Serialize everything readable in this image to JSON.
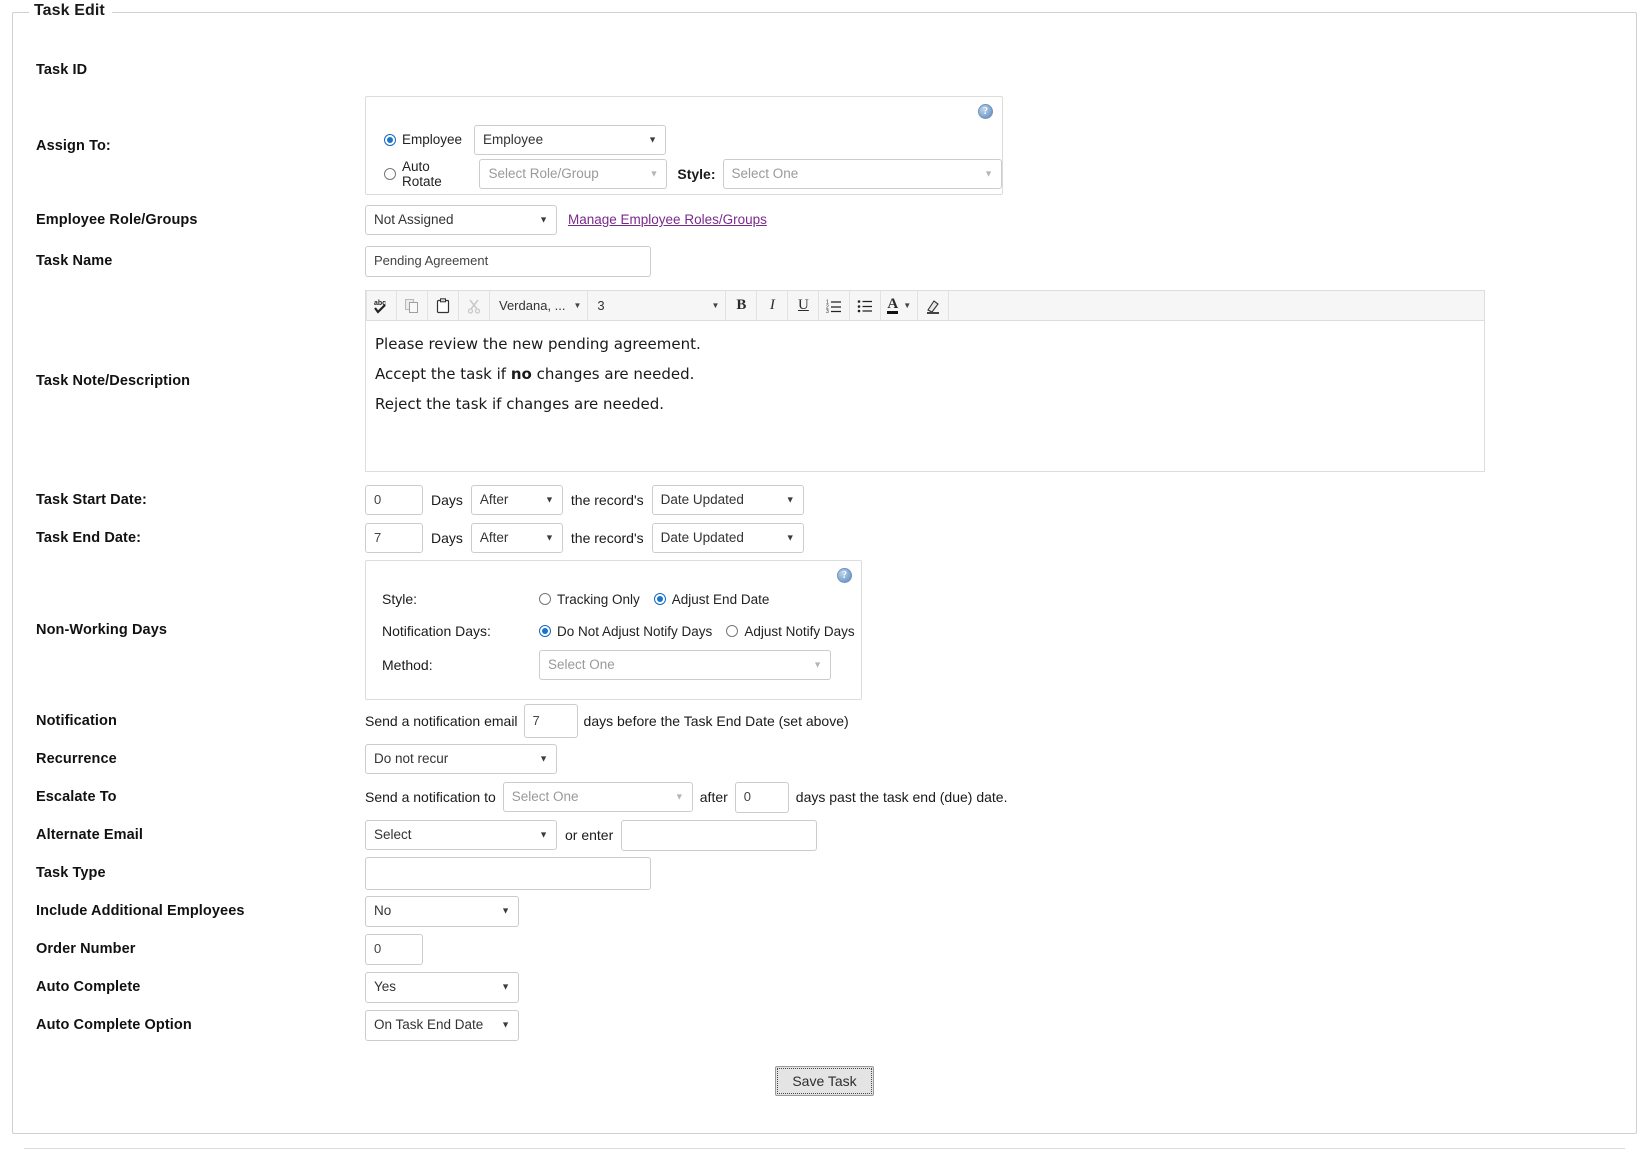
{
  "form": {
    "legend": "Task Edit",
    "save_label": "Save Task",
    "help_icon_glyph": "?"
  },
  "rows": {
    "task_id": {
      "label": "Task ID",
      "value": ""
    },
    "assign_to": {
      "label": "Assign To:",
      "employee_radio_label": "Employee",
      "employee_select_value": "Employee",
      "auto_rotate_radio_label": "Auto Rotate",
      "role_group_select_placeholder": "Select Role/Group",
      "style_label": "Style:",
      "style_select_placeholder": "Select One"
    },
    "employee_role_groups": {
      "label": "Employee Role/Groups",
      "select_value": "Not Assigned",
      "manage_link": "Manage Employee Roles/Groups"
    },
    "task_name": {
      "label": "Task Name",
      "value": "Pending Agreement"
    },
    "task_note": {
      "label": "Task Note/Description",
      "toolbar": {
        "spellcheck": "abc",
        "copy": "copy-icon",
        "paste": "paste-icon",
        "cut": "cut-icon",
        "font_value": "Verdana, ...",
        "size_value": "3",
        "bold": "B",
        "italic": "I",
        "underline": "U",
        "numbered_list": "numbered-list-icon",
        "bulleted_list": "bulleted-list-icon",
        "font_color": "A",
        "highlight": "highlight-icon"
      },
      "paragraphs": [
        {
          "pre": "Please review the new pending agreement.",
          "bold": "",
          "post": ""
        },
        {
          "pre": "Accept the task if ",
          "bold": "no",
          "post": " changes are needed."
        },
        {
          "pre": "Reject the task if changes are needed.",
          "bold": "",
          "post": ""
        }
      ]
    },
    "task_start_date": {
      "label": "Task Start Date:",
      "days_value": "0",
      "days_text": "Days",
      "when_value": "After",
      "record_text": "the record's",
      "field_value": "Date Updated"
    },
    "task_end_date": {
      "label": "Task End Date:",
      "days_value": "7",
      "days_text": "Days",
      "when_value": "After",
      "record_text": "the record's",
      "field_value": "Date Updated"
    },
    "non_working_days": {
      "label": "Non-Working Days",
      "style_label": "Style:",
      "style_opt1": "Tracking Only",
      "style_opt2": "Adjust End Date",
      "notification_days_label": "Notification Days:",
      "notify_opt1": "Do Not Adjust Notify Days",
      "notify_opt2": "Adjust Notify Days",
      "method_label": "Method:",
      "method_value": "Select One"
    },
    "notification": {
      "label": "Notification",
      "pre_text": "Send a notification email",
      "days_value": "7",
      "post_text": "days before the Task End Date (set above)"
    },
    "recurrence": {
      "label": "Recurrence",
      "select_value": "Do not recur"
    },
    "escalate_to": {
      "label": "Escalate To",
      "pre_text": "Send a notification to",
      "select_value": "Select One",
      "mid_text": "after",
      "days_value": "0",
      "post_text": "days past the task end (due) date."
    },
    "alternate_email": {
      "label": "Alternate Email",
      "select_value": "Select",
      "mid_text": "or enter",
      "input_value": ""
    },
    "task_type": {
      "label": "Task Type",
      "value": ""
    },
    "include_additional_employees": {
      "label": "Include Additional Employees",
      "select_value": "No"
    },
    "order_number": {
      "label": "Order Number",
      "value": "0"
    },
    "auto_complete": {
      "label": "Auto Complete",
      "select_value": "Yes"
    },
    "auto_complete_option": {
      "label": "Auto Complete Option",
      "select_value": "On Task End Date"
    }
  },
  "colors": {
    "link": "#7a2a8c",
    "radio_on": "#1874cf",
    "border": "#cccccc",
    "toolbar_bg": "#f6f6f6"
  }
}
